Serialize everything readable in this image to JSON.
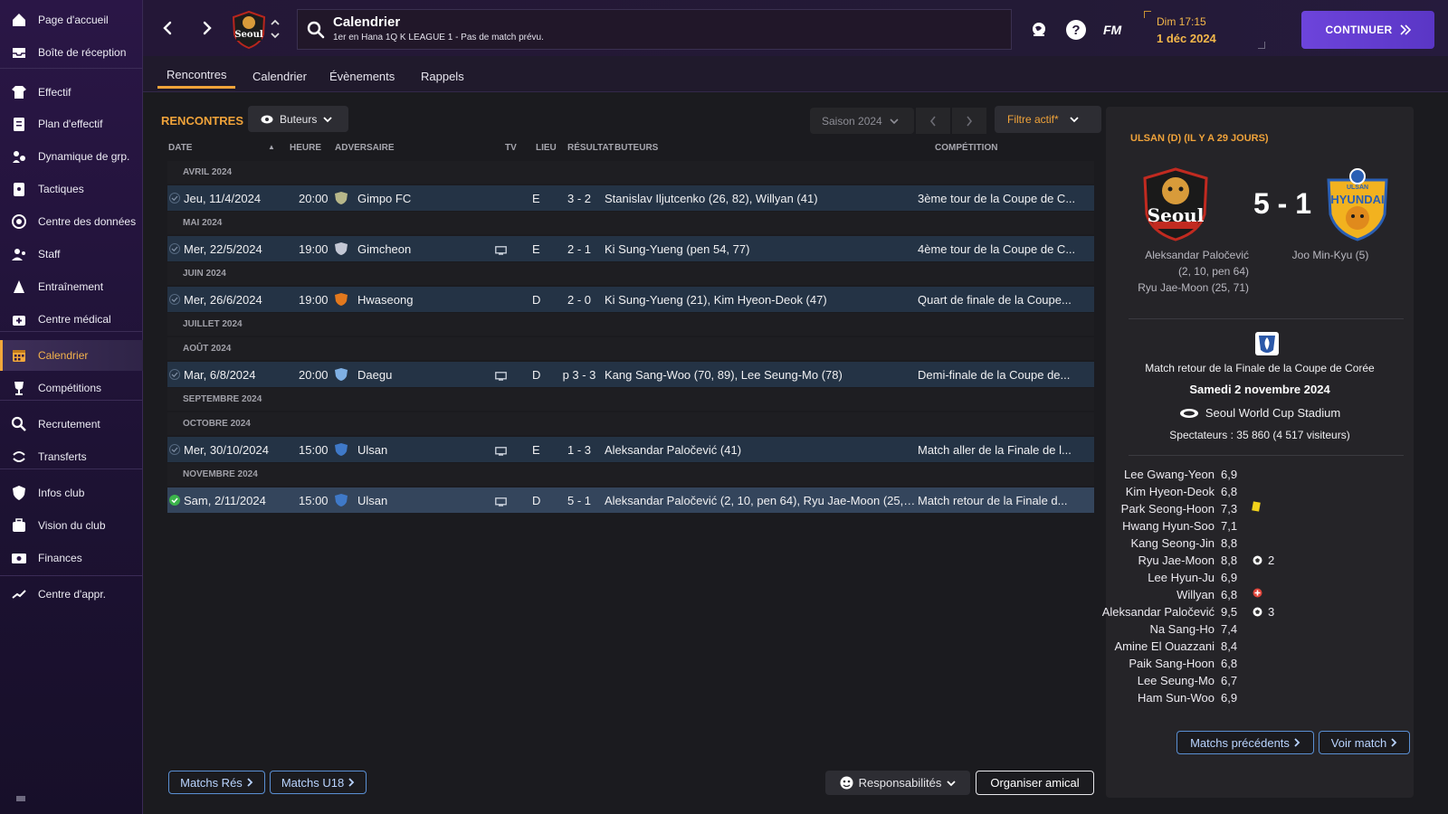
{
  "sidebar": {
    "items": [
      {
        "label": "Page d'accueil",
        "icon": "home-icon"
      },
      {
        "label": "Boîte de réception",
        "icon": "inbox-icon"
      },
      {
        "label": "Effectif",
        "icon": "shirt-icon"
      },
      {
        "label": "Plan d'effectif",
        "icon": "clipboard-icon"
      },
      {
        "label": "Dynamique de grp.",
        "icon": "group-dynamics-icon"
      },
      {
        "label": "Tactiques",
        "icon": "tactics-board-icon"
      },
      {
        "label": "Centre des données",
        "icon": "data-circle-icon"
      },
      {
        "label": "Staff",
        "icon": "staff-icon"
      },
      {
        "label": "Entraînement",
        "icon": "training-cone-icon"
      },
      {
        "label": "Centre médical",
        "icon": "medical-kit-icon"
      },
      {
        "label": "Calendrier",
        "icon": "calendar-icon"
      },
      {
        "label": "Compétitions",
        "icon": "trophy-icon"
      },
      {
        "label": "Recrutement",
        "icon": "magnifier-icon"
      },
      {
        "label": "Transferts",
        "icon": "transfer-arrows-icon"
      },
      {
        "label": "Infos club",
        "icon": "shield-icon"
      },
      {
        "label": "Vision du club",
        "icon": "briefcase-icon"
      },
      {
        "label": "Finances",
        "icon": "money-icon"
      },
      {
        "label": "Centre d'appr.",
        "icon": "trend-icon"
      }
    ]
  },
  "header": {
    "club_logo_text": "Seoul",
    "title": "Calendrier",
    "subtitle": "1er en Hana 1Q K LEAGUE 1 - Pas de match prévu.",
    "fm_label": "FM",
    "day_time": "Dim 17:15",
    "date": "1 déc 2024",
    "continue_label": "CONTINUER"
  },
  "tabs": [
    "Rencontres",
    "Calendrier",
    "Évènements",
    "Rappels"
  ],
  "toolbar": {
    "section_title": "RENCONTRES",
    "view_dropdown": "Buteurs",
    "season": "Saison 2024",
    "filter": "Filtre actif*"
  },
  "table": {
    "headers": {
      "date": "DATE",
      "time": "HEURE",
      "opponent": "ADVERSAIRE",
      "tv": "TV",
      "venue": "LIEU",
      "result": "RÉSULTAT",
      "scorers": "BUTEURS",
      "competition": "COMPÉTITION"
    },
    "groups": [
      {
        "month": "AVRIL 2024",
        "matches": [
          {
            "date": "Jeu, 11/4/2024",
            "time": "20:00",
            "opponent": "Gimpo FC",
            "badge": "#b7b78a",
            "tv": false,
            "venue": "E",
            "result": "3 - 2",
            "scorers": "Stanislav Iljutcenko (26, 82), Willyan (41)",
            "competition": "3ème tour de la Coupe de C...",
            "selected": false,
            "won": false
          }
        ]
      },
      {
        "month": "MAI 2024",
        "matches": [
          {
            "date": "Mer, 22/5/2024",
            "time": "19:00",
            "opponent": "Gimcheon",
            "badge": "#c3c7d4",
            "tv": true,
            "venue": "E",
            "result": "2 - 1",
            "scorers": "Ki Sung-Yueng (pen 54, 77)",
            "competition": "4ème tour de la Coupe de C...",
            "selected": false,
            "won": false
          }
        ]
      },
      {
        "month": "JUIN 2024",
        "matches": [
          {
            "date": "Mer, 26/6/2024",
            "time": "19:00",
            "opponent": "Hwaseong",
            "badge": "#e2781d",
            "tv": false,
            "venue": "D",
            "result": "2 - 0",
            "scorers": "Ki Sung-Yueng (21), Kim Hyeon-Deok (47)",
            "competition": "Quart de finale de la Coupe...",
            "selected": false,
            "won": false
          }
        ]
      },
      {
        "month": "JUILLET 2024",
        "matches": []
      },
      {
        "month": "AOÛT 2024",
        "matches": [
          {
            "date": "Mar, 6/8/2024",
            "time": "20:00",
            "opponent": "Daegu",
            "badge": "#7fb0e4",
            "tv": true,
            "venue": "D",
            "result": "p 3 - 3",
            "scorers": "Kang Sang-Woo (70, 89), Lee Seung-Mo (78)",
            "competition": "Demi-finale de la Coupe de...",
            "selected": false,
            "won": false
          }
        ]
      },
      {
        "month": "SEPTEMBRE 2024",
        "matches": []
      },
      {
        "month": "OCTOBRE 2024",
        "matches": [
          {
            "date": "Mer, 30/10/2024",
            "time": "15:00",
            "opponent": "Ulsan",
            "badge": "#3f79c8",
            "tv": true,
            "venue": "E",
            "result": "1 - 3",
            "scorers": "Aleksandar Paločević (41)",
            "competition": "Match aller de la Finale de l...",
            "selected": false,
            "won": false
          }
        ]
      },
      {
        "month": "NOVEMBRE 2024",
        "matches": [
          {
            "date": "Sam, 2/11/2024",
            "time": "15:00",
            "opponent": "Ulsan",
            "badge": "#3f79c8",
            "tv": true,
            "venue": "D",
            "result": "5 - 1",
            "scorers": "Aleksandar Paločević (2, 10, pen 64), Ryu Jae-Moon (25, 71)",
            "competition": "Match retour de la Finale d...",
            "selected": true,
            "won": true
          }
        ]
      }
    ]
  },
  "footer_buttons": {
    "res_matches": "Matchs Rés",
    "u18_matches": "Matchs U18",
    "responsibilities": "Responsabilités",
    "friendly": "Organiser amical"
  },
  "match_panel": {
    "heading": "ULSAN (D) (IL Y A 29 JOURS)",
    "score": "5 - 1",
    "home_logo_text": "Seoul",
    "away_logo_text": "HYUNDAI",
    "away_logo_top": "ULSAN",
    "home_scorers": [
      "Aleksandar Paločević",
      "(2, 10, pen 64)",
      "Ryu Jae-Moon (25, 71)"
    ],
    "away_scorers": [
      "Joo Min-Kyu (5)"
    ],
    "competition": "Match retour de la Finale de la Coupe de Corée",
    "date": "Samedi 2 novembre 2024",
    "stadium": "Seoul World Cup Stadium",
    "attendance": "Spectateurs : 35 860 (4 517 visiteurs)",
    "players": [
      {
        "name": "Lee Gwang-Yeon",
        "rating": "6,9",
        "event": "",
        "goals": ""
      },
      {
        "name": "Kim Hyeon-Deok",
        "rating": "6,8",
        "event": "",
        "goals": ""
      },
      {
        "name": "Park Seong-Hoon",
        "rating": "7,3",
        "event": "yellow-card",
        "goals": ""
      },
      {
        "name": "Hwang Hyun-Soo",
        "rating": "7,1",
        "event": "",
        "goals": ""
      },
      {
        "name": "Kang Seong-Jin",
        "rating": "8,8",
        "event": "",
        "goals": ""
      },
      {
        "name": "Ryu Jae-Moon",
        "rating": "8,8",
        "event": "goal",
        "goals": "2"
      },
      {
        "name": "Lee Hyun-Ju",
        "rating": "6,9",
        "event": "",
        "goals": ""
      },
      {
        "name": "Willyan",
        "rating": "6,8",
        "event": "injury",
        "goals": ""
      },
      {
        "name": "Aleksandar Paločević",
        "rating": "9,5",
        "event": "goal",
        "goals": "3"
      },
      {
        "name": "Na Sang-Ho",
        "rating": "7,4",
        "event": "",
        "goals": ""
      },
      {
        "name": "Amine El Ouazzani",
        "rating": "8,4",
        "event": "",
        "goals": ""
      },
      {
        "name": "Paik Sang-Hoon",
        "rating": "6,8",
        "event": "",
        "goals": ""
      },
      {
        "name": "Lee Seung-Mo",
        "rating": "6,7",
        "event": "",
        "goals": ""
      },
      {
        "name": "Ham Sun-Woo",
        "rating": "6,9",
        "event": "",
        "goals": ""
      }
    ],
    "prev_matches": "Matchs précédents",
    "view_match": "Voir match"
  },
  "colors": {
    "accent": "#f0a33a",
    "purple_button": "#6a3fd8",
    "row_bg": "#243345",
    "row_selected": "#34455c",
    "link_blue": "#5a8fd3",
    "date_yellow": "#f5b84a"
  }
}
